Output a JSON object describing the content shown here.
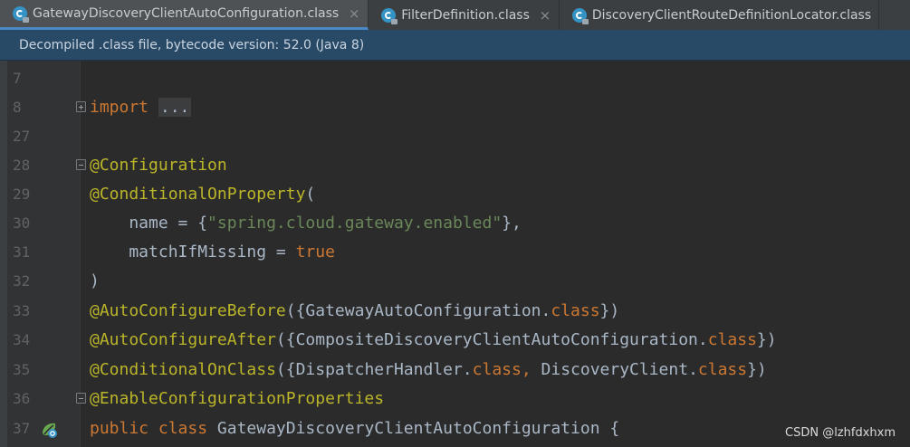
{
  "tabs": [
    {
      "label": "GatewayDiscoveryClientAutoConfiguration.class",
      "active": true,
      "close": "×"
    },
    {
      "label": "FilterDefinition.class",
      "active": false,
      "close": "×"
    },
    {
      "label": "DiscoveryClientRouteDefinitionLocator.class",
      "active": false,
      "close": "×"
    }
  ],
  "banner": "Decompiled .class file, bytecode version: 52.0 (Java 8)",
  "lines": [
    {
      "n": "7"
    },
    {
      "n": "8",
      "t1": "import",
      "t2": "..."
    },
    {
      "n": "27"
    },
    {
      "n": "28",
      "t1": "@Configuration"
    },
    {
      "n": "29",
      "t1": "@ConditionalOnProperty",
      "t2": "("
    },
    {
      "n": "30",
      "t1": "    name = {",
      "t2": "\"spring.cloud.gateway.enabled\"",
      "t3": "},"
    },
    {
      "n": "31",
      "t1": "    matchIfMissing = ",
      "t2": "true"
    },
    {
      "n": "32",
      "t1": ")"
    },
    {
      "n": "33",
      "t1": "@AutoConfigureBefore",
      "t2": "({GatewayAutoConfiguration.",
      "t3": "class",
      "t4": "})"
    },
    {
      "n": "34",
      "t1": "@AutoConfigureAfter",
      "t2": "({CompositeDiscoveryClientAutoConfiguration.",
      "t3": "class",
      "t4": "})"
    },
    {
      "n": "35",
      "t1": "@ConditionalOnClass",
      "t2": "({DispatcherHandler.",
      "t3": "class, ",
      "t4": "DiscoveryClient.",
      "t5": "class",
      "t6": "})"
    },
    {
      "n": "36",
      "t1": "@EnableConfigurationProperties"
    },
    {
      "n": "37",
      "t1": "public class ",
      "t2": "GatewayDiscoveryClientAutoConfiguration {"
    }
  ],
  "watermark": "CSDN @lzhfdxhxm",
  "colors": {
    "keyword": "#cc7832",
    "annotation": "#bbb529",
    "string": "#6a8759",
    "text": "#a9b7c6",
    "banner": "#294a66"
  }
}
